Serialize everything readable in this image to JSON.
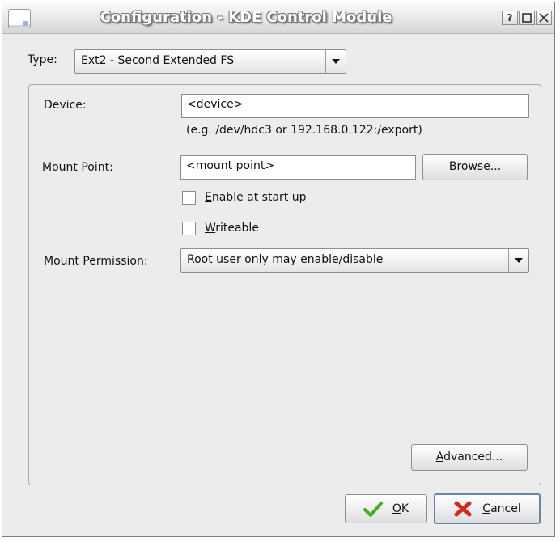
{
  "window": {
    "title": "Configuration - KDE Control Module",
    "help_label": "?",
    "maximize_label": "□",
    "close_label": "✕"
  },
  "type": {
    "label": "Type:",
    "value": "Ext2 - Second Extended FS"
  },
  "device": {
    "label": "Device:",
    "value": "<device>",
    "hint": "(e.g. /dev/hdc3 or 192.168.0.122:/export)"
  },
  "mount_point": {
    "label": "Mount Point:",
    "value": "<mount point>",
    "browse_label": "Browse...",
    "browse_mnemonic": "B",
    "browse_rest": "rowse..."
  },
  "options": {
    "enable_at_startup": {
      "mnemonic": "E",
      "rest": "nable at start up",
      "checked": false
    },
    "writeable": {
      "mnemonic": "W",
      "rest": "riteable",
      "checked": false
    }
  },
  "permission": {
    "label": "Mount Permission:",
    "value": "Root user only may enable/disable"
  },
  "advanced": {
    "mnemonic": "A",
    "rest": "dvanced..."
  },
  "footer": {
    "ok": {
      "mnemonic": "O",
      "rest": "K"
    },
    "cancel": {
      "mnemonic": "C",
      "rest": "ancel"
    }
  },
  "icons": {
    "ok": "checkmark-icon",
    "cancel": "cross-icon",
    "app": "window-app-icon"
  },
  "colors": {
    "ok_icon": "#3fae1d",
    "cancel_icon": "#d42a1e",
    "default_button_border": "#6a82a8"
  }
}
